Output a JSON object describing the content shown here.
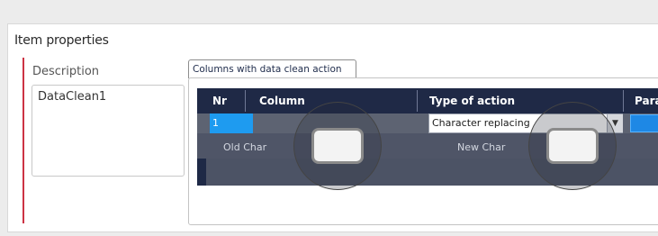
{
  "group": {
    "title": "Item properties"
  },
  "description": {
    "label": "Description",
    "value": "DataClean1"
  },
  "tab": {
    "label": "Columns with data clean action"
  },
  "grid": {
    "headers": [
      "Nr",
      "Column",
      "Type of action",
      "Para"
    ],
    "row": {
      "nr": "1",
      "column": "",
      "action": "Character replacing",
      "param": ""
    },
    "sub_labels": {
      "old": "Old Char",
      "new": "New Char"
    },
    "old_char_value": "",
    "new_char_value": ""
  },
  "colors": {
    "grid_header": "#1f2946",
    "selected_cell": "#1e9bf0",
    "row_bg": "#5d6372",
    "accent_line": "#cc3344"
  },
  "icons": {
    "dropdown": "chevron-down-icon"
  }
}
